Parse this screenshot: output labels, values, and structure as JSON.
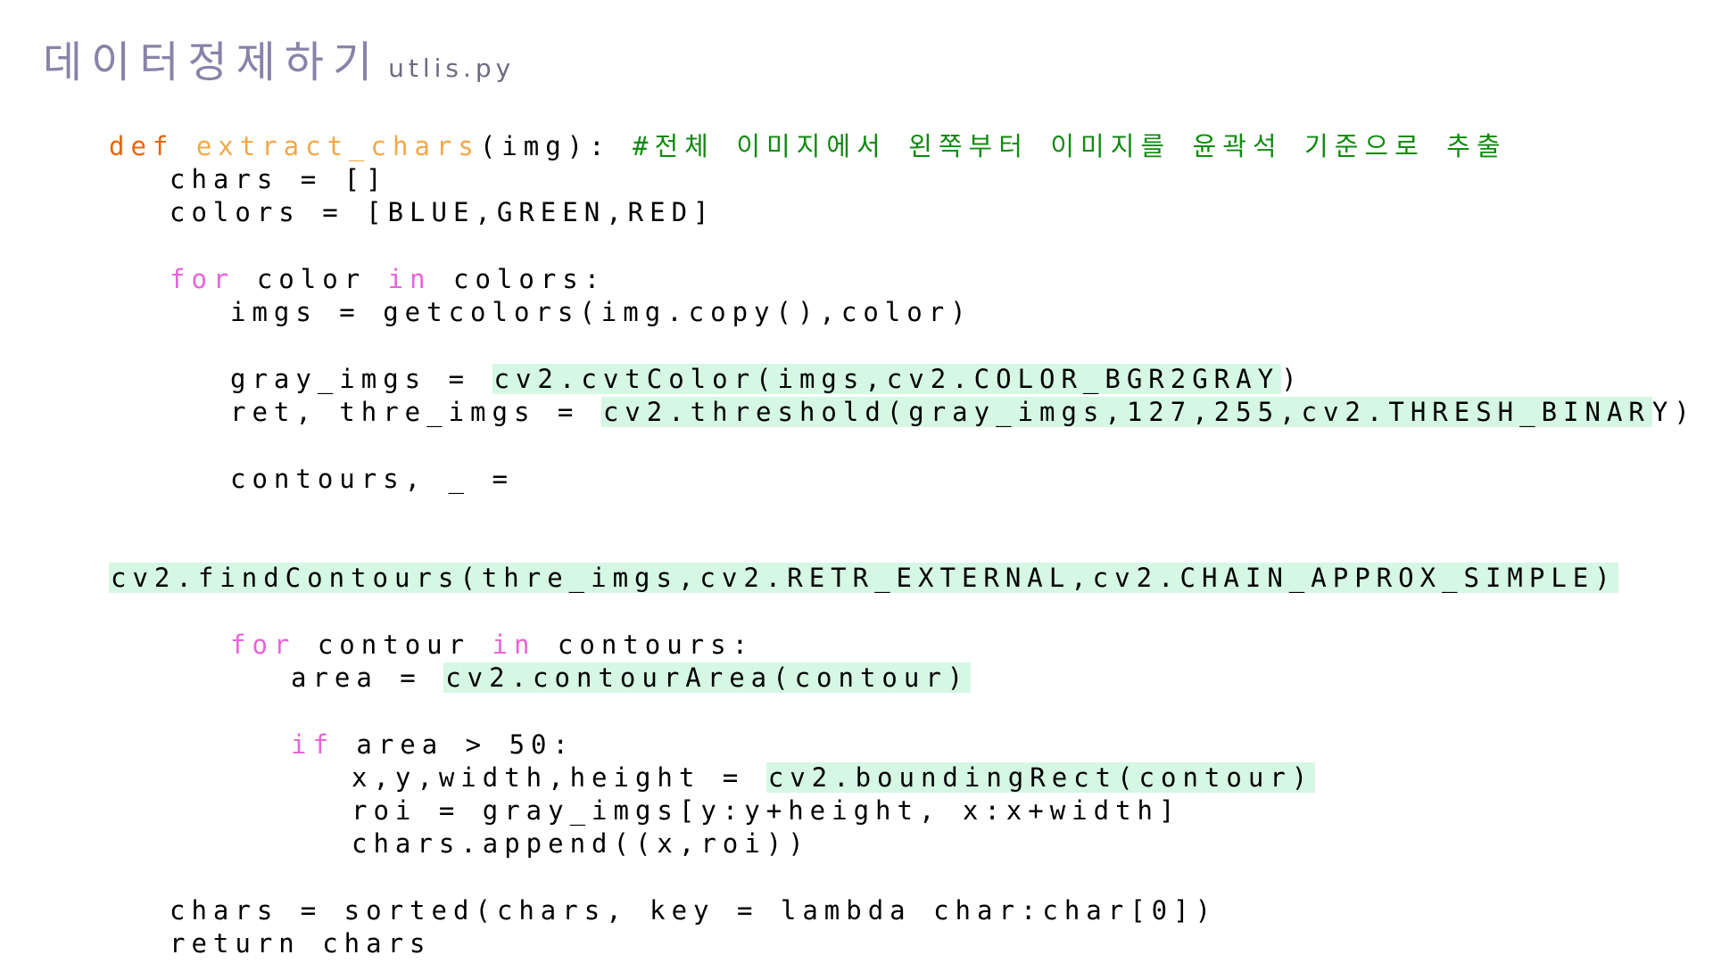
{
  "title": {
    "main": "데이터정제하기",
    "sub": "utlis.py"
  },
  "code": {
    "l1": {
      "def": "def ",
      "name": "extract_chars",
      "args": "(img): ",
      "comment": "#전체 이미지에서 왼쪽부터 이미지를 윤곽석 기준으로 추출"
    },
    "l2": "chars = []",
    "l3": "colors = [BLUE,GREEN,RED]",
    "l4": {
      "kw_for": "for",
      "mid": " color ",
      "kw_in": "in",
      "rest": " colors:"
    },
    "l5": "imgs = getcolors(img.copy(),color)",
    "l6": {
      "pre": "gray_imgs = ",
      "hl": "cv2.cvtColor(imgs,cv2.COLOR_BGR2GRAY",
      "post": ")"
    },
    "l7": {
      "pre": "ret, thre_imgs = ",
      "hl": "cv2.threshold(gray_imgs,127,255,cv2.THRESH_BINAR",
      "post": "Y)"
    },
    "l8": "contours, _ =",
    "l9": {
      "hl": "cv2.findContours(thre_imgs,cv2.RETR_EXTERNAL,cv2.CHAIN_APPROX_SIMPLE)"
    },
    "l10": {
      "kw_for": "for",
      "mid": " contour ",
      "kw_in": "in",
      "rest": " contours:"
    },
    "l11": {
      "pre": "area = ",
      "hl": "cv2.contourArea(contour)"
    },
    "l12": {
      "kw_if": "if",
      "rest": " area > 50:"
    },
    "l13": {
      "pre": "x,y,width,height = ",
      "hl": "cv2.boundingRect(contour)"
    },
    "l14": "roi = gray_imgs[y:y+height, x:x+width]",
    "l15": "chars.append((x,roi))",
    "l16": "chars = sorted(chars, key = lambda char:char[0])",
    "l17": "return chars"
  },
  "colors": {
    "title": "#8a82a8",
    "def_keyword": "#e8650c",
    "function_name": "#f0a94a",
    "control_keyword": "#e864d8",
    "comment": "#108a10",
    "highlight": "#d5f7e4"
  }
}
